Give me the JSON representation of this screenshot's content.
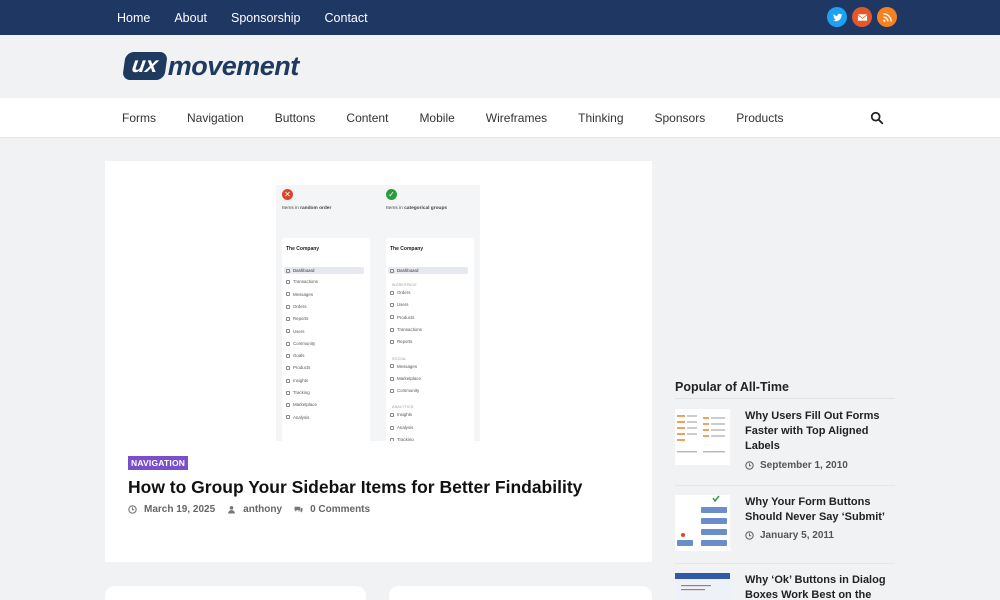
{
  "topnav": {
    "items": [
      "Home",
      "About",
      "Sponsorship",
      "Contact"
    ]
  },
  "social": [
    {
      "icon": "twitter-icon",
      "color": "#1da1f2"
    },
    {
      "icon": "email-icon",
      "color": "#e2582b"
    },
    {
      "icon": "rss-icon",
      "color": "#f58220"
    }
  ],
  "logo": {
    "ux": "ux",
    "rest": "movement"
  },
  "categories": [
    "Forms",
    "Navigation",
    "Buttons",
    "Content",
    "Mobile",
    "Wireframes",
    "Thinking",
    "Sponsors",
    "Products"
  ],
  "featured": {
    "badge": "NAVIGATION",
    "title": "How to Group Your Sidebar Items for Better Findability",
    "date": "March 19, 2025",
    "author": "anthony",
    "comments": "0 Comments",
    "image": {
      "left": {
        "caption_prefix": "Items in ",
        "caption_bold": "random order",
        "brand": "The Company",
        "items": [
          "Dashboard",
          "Transactions",
          "Messages",
          "Orders",
          "Reports",
          "Users",
          "Community",
          "Goals",
          "Products",
          "Insights",
          "Tracking",
          "Marketplace",
          "Analysis"
        ]
      },
      "right": {
        "caption_prefix": "Items in ",
        "caption_bold": "categorical groups",
        "brand": "The Company",
        "dashboard": "Dashboard",
        "groups": [
          {
            "head": "WORKSPACE",
            "items": [
              "Orders",
              "Users",
              "Products",
              "Transactions",
              "Reports"
            ]
          },
          {
            "head": "SOCIAL",
            "items": [
              "Messages",
              "Marketplace",
              "Community"
            ]
          },
          {
            "head": "ANALYTICS",
            "items": [
              "Insights",
              "Analysis",
              "Tracking",
              "Goals"
            ]
          }
        ]
      }
    }
  },
  "sidebar": {
    "title": "Popular of All-Time",
    "posts": [
      {
        "title": "Why Users Fill Out Forms Faster with Top Aligned Labels",
        "date": "September 1, 2010"
      },
      {
        "title": "Why Your Form Buttons Should Never Say ‘Submit’",
        "date": "January 5, 2011"
      },
      {
        "title": "Why ‘Ok’ Buttons in Dialog Boxes Work Best on the",
        "date": ""
      }
    ]
  }
}
